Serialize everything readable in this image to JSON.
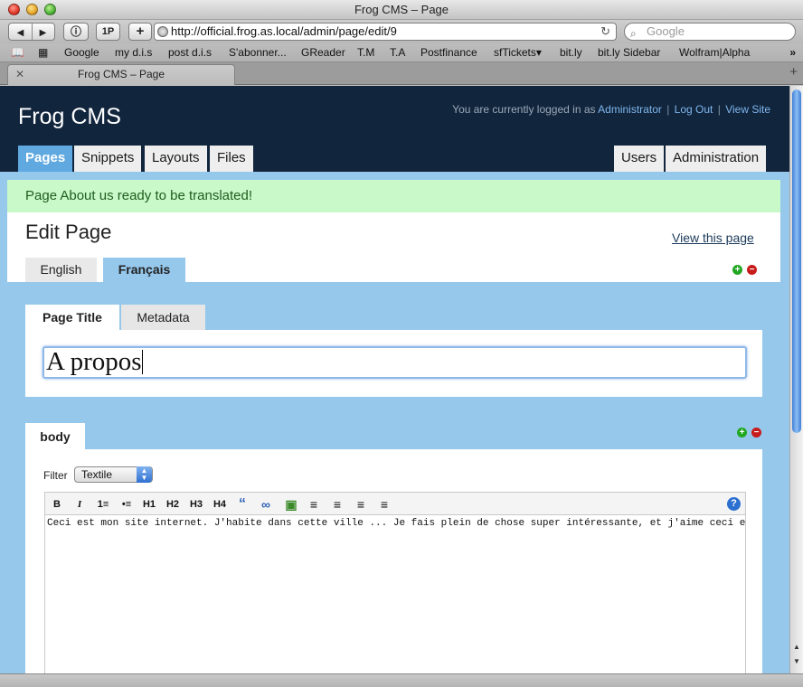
{
  "browser": {
    "window_title": "Frog CMS – Page",
    "url": "http://official.frog.as.local/admin/page/edit/9",
    "search_placeholder": "Google",
    "tab_title": "Frog CMS – Page",
    "buttons": {
      "reader": "ⓘ",
      "onepassword": "1P",
      "add": "+"
    },
    "bookmarks": [
      "Google",
      "my d.i.s",
      "post d.i.s",
      "S'abonner...",
      "GReader",
      "T.M",
      "T.A",
      "Postfinance",
      "sfTickets▾",
      "bit.ly",
      "bit.ly Sidebar",
      "Wolfram|Alpha"
    ]
  },
  "header": {
    "logo": "Frog CMS",
    "login_text": "You are currently logged in as",
    "user": "Administrator",
    "logout": "Log Out",
    "view_site": "View Site",
    "tabs_left": [
      "Pages",
      "Snippets",
      "Layouts",
      "Files"
    ],
    "tabs_right": [
      "Users",
      "Administration"
    ]
  },
  "notice": "Page About us ready to be translated!",
  "page": {
    "heading": "Edit Page",
    "view_link": "View this page",
    "languages": [
      "English",
      "Français"
    ],
    "active_language": "Français",
    "subtabs": [
      "Page Title",
      "Metadata"
    ],
    "title_value": "A propos"
  },
  "body_part": {
    "tab": "body",
    "filter_label": "Filter",
    "filter_value": "Textile",
    "toolbar": [
      "B",
      "I",
      "1≡",
      "•≡",
      "H1",
      "H2",
      "H3",
      "H4",
      "“",
      "∞",
      "▣",
      "≡",
      "≡",
      "≡",
      "≡"
    ],
    "help": "?",
    "content": "Ceci est mon site internet. J'habite dans cette ville ... Je fais plein de chose super intéressante, et j'aime ceci et ça ..."
  },
  "colors": {
    "header_bg": "#11253d",
    "page_bg": "#96c8ec",
    "active_tab": "#5fa8e0",
    "notice_bg": "#c9f8c9"
  }
}
